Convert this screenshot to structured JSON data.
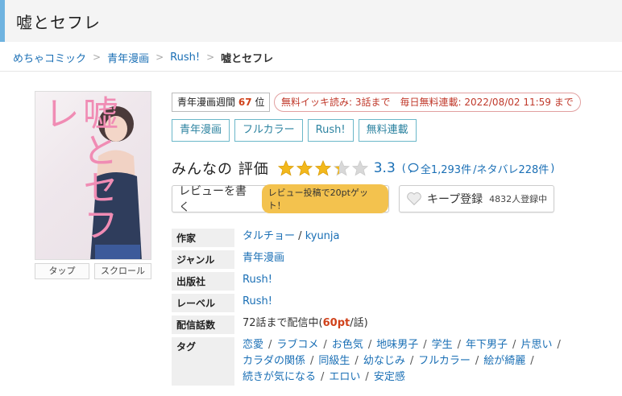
{
  "title": "嘘とセフレ",
  "breadcrumb": [
    "めちゃコミック",
    "青年漫画",
    "Rush!",
    "嘘とセフレ"
  ],
  "cover": {
    "title_text": "嘘とセフレ",
    "buttons": [
      "タップ",
      "スクロール"
    ]
  },
  "ranking": {
    "prefix": "青年漫画週間",
    "rank": "67",
    "suffix": "位"
  },
  "free_badge": "無料イッキ読み: 3話まで　毎日無料連載: 2022/08/02 11:59 まで",
  "genre_tags": [
    "青年漫画",
    "フルカラー",
    "Rush!",
    "無料連載"
  ],
  "rating": {
    "label": "みんなの 評価",
    "score": "3.3",
    "stars_value": 3.3,
    "counts_open": "(",
    "total": "全1,293件",
    "spoilers": "/ネタバレ228件",
    "counts_close": ")"
  },
  "review_button": {
    "label": "レビューを書く",
    "promo": "レビュー投稿で20ptゲット！"
  },
  "keep_button": {
    "label": "キープ登録",
    "count": "4832人登録中"
  },
  "info": {
    "author_key": "作家",
    "author_1": "タルチョー",
    "author_sep": "/",
    "author_2": "kyunja",
    "genre_key": "ジャンル",
    "genre": "青年漫画",
    "publisher_key": "出版社",
    "publisher": "Rush!",
    "label_key": "レーベル",
    "label": "Rush!",
    "episodes_key": "配信話数",
    "episodes_pre": "72話まで配信中(",
    "episodes_pt": "60pt",
    "episodes_post": "/話)",
    "tags_key": "タグ",
    "tags": [
      "恋愛",
      "ラブコメ",
      "お色気",
      "地味男子",
      "学生",
      "年下男子",
      "片思い",
      "カラダの関係",
      "同級生",
      "幼なじみ",
      "フルカラー",
      "絵が綺麗",
      "続きが気になる",
      "エロい",
      "安定感"
    ]
  },
  "colors": {
    "accent": "#6fb3e0",
    "link": "#1a6fb5",
    "star": "#f3b81b",
    "red": "#d0421b"
  }
}
